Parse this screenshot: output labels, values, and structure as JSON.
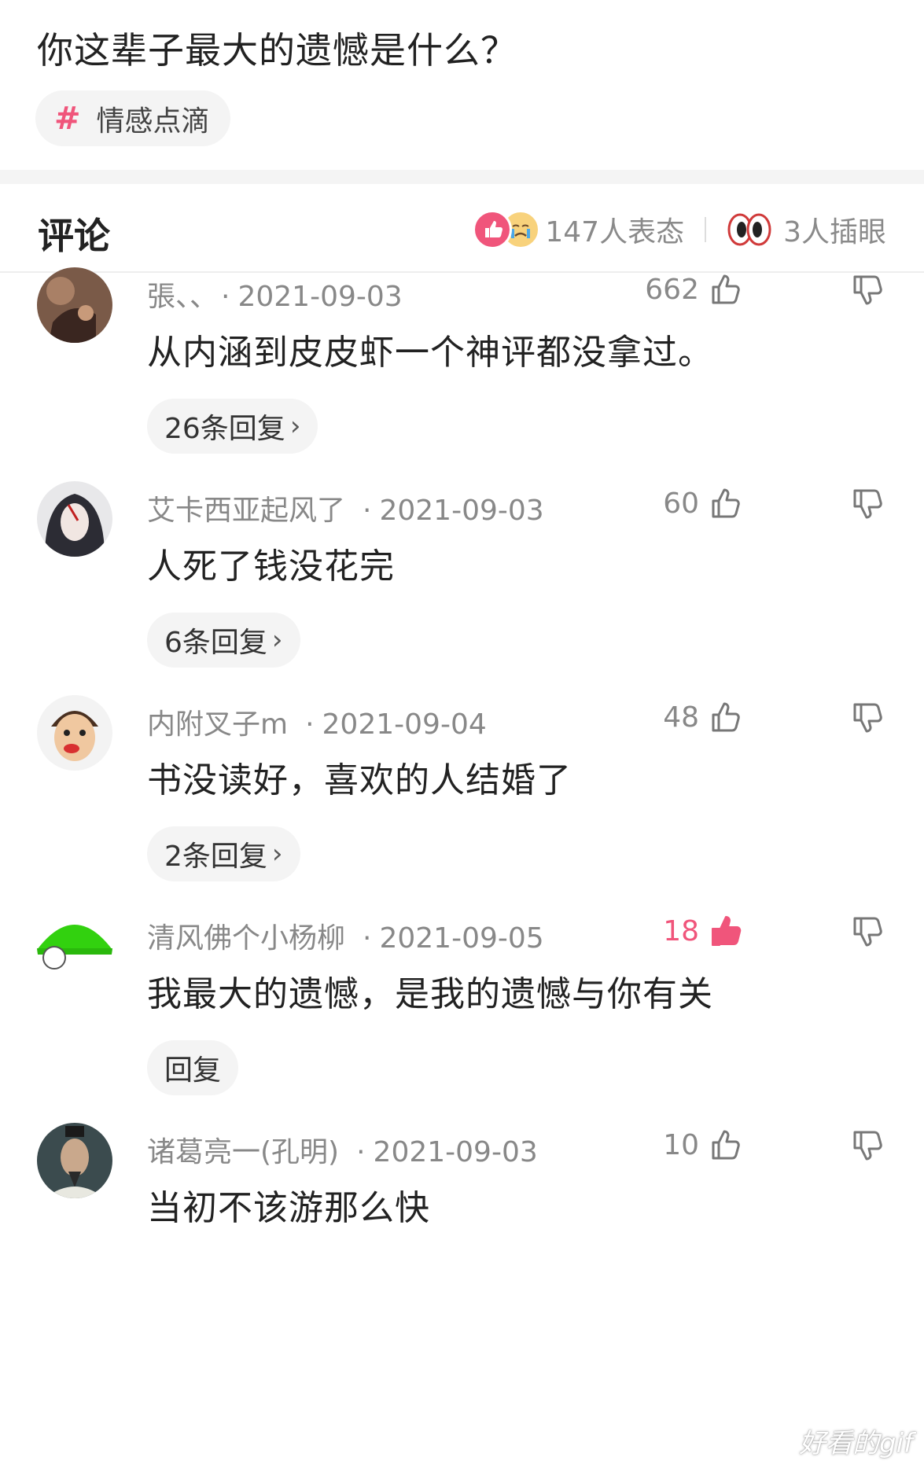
{
  "question": "你这辈子最大的遗憾是什么？",
  "topic": {
    "hash": "#",
    "label": "情感点滴"
  },
  "comments_header": {
    "title": "评论",
    "reactions_label": "147人表态",
    "poke_label": "3人插眼"
  },
  "comments": [
    {
      "user": "張、、",
      "date": "2021-09-03",
      "likes": "662",
      "liked": false,
      "text": "从内涵到皮皮虾一个神评都没拿过。",
      "replies": "26条回复",
      "avatar_color": "#7a5a48"
    },
    {
      "user": "艾卡西亚起风了",
      "date": "2021-09-03",
      "likes": "60",
      "liked": false,
      "text": "人死了钱没花完",
      "replies": "6条回复",
      "avatar_color": "#3a3a44"
    },
    {
      "user": "内附叉子m",
      "date": "2021-09-04",
      "likes": "48",
      "liked": false,
      "text": "书没读好，喜欢的人结婚了",
      "replies": "2条回复",
      "avatar_color": "#e9c7a5"
    },
    {
      "user": "清风佛个小杨柳",
      "date": "2021-09-05",
      "likes": "18",
      "liked": true,
      "text": "我最大的遗憾，是我的遗憾与你有关",
      "replies": "回复",
      "avatar_color": "#32d10f"
    },
    {
      "user": "诸葛亮一(孔明)",
      "date": "2021-09-03",
      "likes": "10",
      "liked": false,
      "text": "当初不该游那么快",
      "replies": "",
      "avatar_color": "#3b4b4e"
    }
  ],
  "watermark": "好看的gif",
  "colors": {
    "accent": "#f0557b",
    "muted": "#888888",
    "pill_bg": "#f4f4f4"
  },
  "icons": [
    "thumb-up-icon",
    "thumb-down-icon",
    "chevron-right-icon",
    "hash-icon"
  ]
}
